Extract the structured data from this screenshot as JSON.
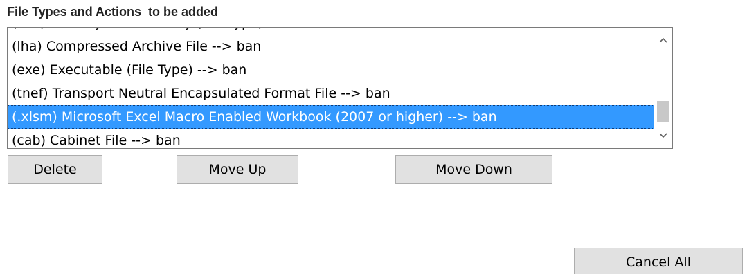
{
  "section": {
    "title": "File Types and Actions  to be added"
  },
  "file_type_list": {
    "items": [
      {
        "label": "(xxx) Partially Hidden Entry (File Type) --> ban",
        "selected": false
      },
      {
        "label": "(lha) Compressed Archive File --> ban",
        "selected": false
      },
      {
        "label": "(exe) Executable (File Type) --> ban",
        "selected": false
      },
      {
        "label": "(tnef) Transport Neutral Encapsulated Format File --> ban",
        "selected": false
      },
      {
        "label": "(.xlsm) Microsoft Excel Macro Enabled Workbook (2007 or higher) --> ban",
        "selected": true
      },
      {
        "label": "(cab) Cabinet File --> ban",
        "selected": false
      }
    ],
    "scrollbar": {
      "up_icon": "chevron-up-icon",
      "down_icon": "chevron-down-icon"
    }
  },
  "actions": {
    "delete_label": "Delete",
    "move_up_label": "Move Up",
    "move_down_label": "Move Down"
  },
  "footer": {
    "cancel_all_label": "Cancel All"
  },
  "colors": {
    "selection_background": "#3399ff",
    "selection_text": "#ffffff",
    "button_face": "#e1e1e1",
    "button_border": "#adadad"
  }
}
